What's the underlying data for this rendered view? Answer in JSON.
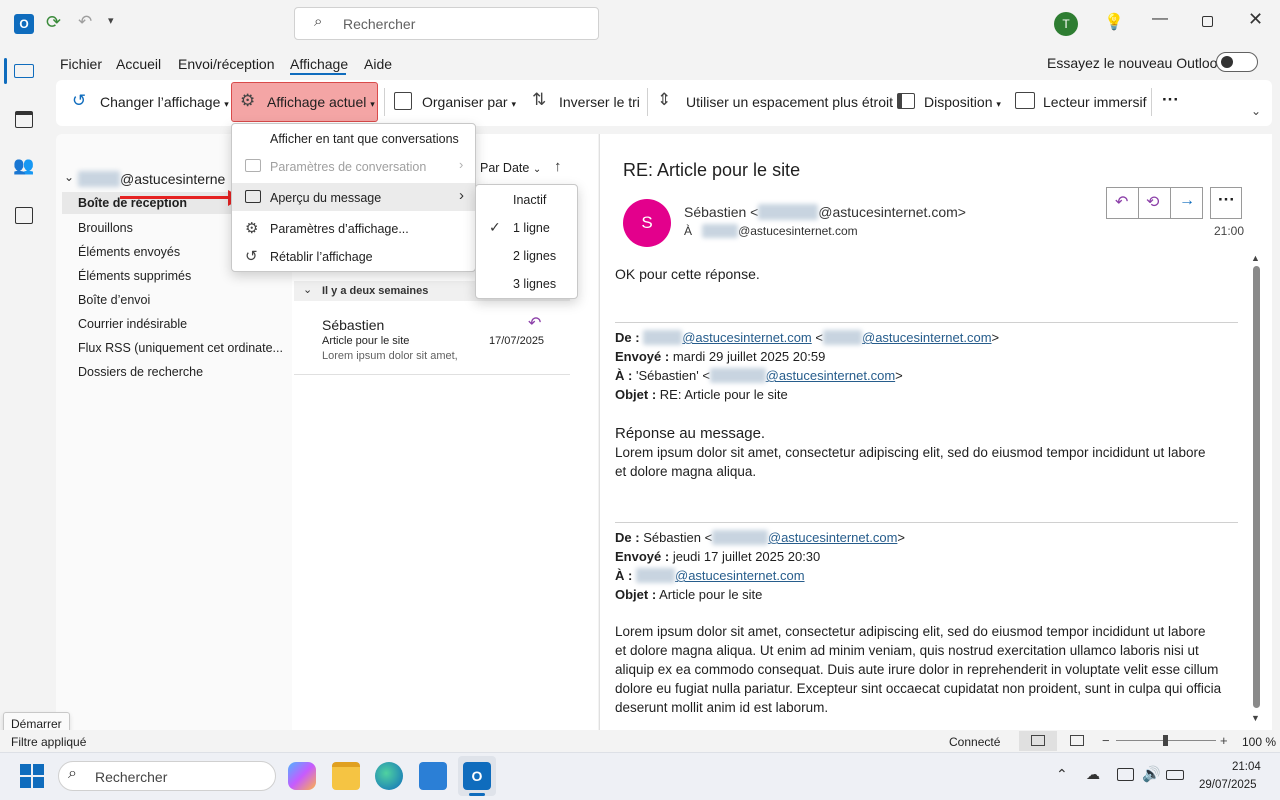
{
  "titlebar": {
    "search_placeholder": "Rechercher",
    "avatar_initial": "T"
  },
  "menubar": {
    "items": [
      "Fichier",
      "Accueil",
      "Envoi/réception",
      "Affichage",
      "Aide"
    ],
    "active": "Affichage",
    "try_new_label": "Essayez le nouveau Outlook"
  },
  "ribbon": {
    "change_view": "Changer l’affichage",
    "current_view": "Affichage actuel",
    "arrange_by": "Organiser par",
    "reverse_sort": "Inverser le tri",
    "compact_spacing": "Utiliser un espacement plus étroit",
    "layout": "Disposition",
    "immersive_reader": "Lecteur immersif",
    "more": "···"
  },
  "current_view_menu": {
    "items": [
      {
        "label": "Afficher en tant que conversations",
        "enabled": true
      },
      {
        "label": "Paramètres de conversation",
        "enabled": false,
        "submenu": true
      },
      {
        "label": "Aperçu du message",
        "enabled": true,
        "submenu": true,
        "highlighted": true
      },
      {
        "label": "Paramètres d’affichage...",
        "enabled": true
      },
      {
        "label": "Rétablir l’affichage",
        "enabled": true
      }
    ]
  },
  "preview_submenu": {
    "items": [
      "Inactif",
      "1 ligne",
      "2 lignes",
      "3 lignes"
    ],
    "checked": "1 ligne"
  },
  "folders": {
    "account": "@astucesinterne",
    "items": [
      "Boîte de réception",
      "Brouillons",
      "Éléments envoyés",
      "Éléments supprimés",
      "Boîte d’envoi",
      "Courrier indésirable",
      "Flux RSS (uniquement cet ordinate...",
      "Dossiers de recherche"
    ],
    "selected": "Boîte de réception"
  },
  "message_list": {
    "sort_label": "Par Date",
    "group_header": "Il y a deux semaines",
    "items": [
      {
        "sender": "Sébastien",
        "subject": "Article pour le site",
        "preview": "Lorem ipsum dolor sit amet,",
        "date": "17/07/2025"
      }
    ]
  },
  "reading_pane": {
    "subject": "RE: Article pour le site",
    "avatar_initial": "S",
    "from_name": "Sébastien <",
    "from_domain": "@astucesinternet.com>",
    "to_prefix": "À",
    "to_domain": "@astucesinternet.com",
    "time": "21:00",
    "body_intro": "OK pour cette réponse.",
    "quote1": {
      "from_label": "De :",
      "from_domain1": "@astucesinternet.com",
      "from_domain2": "@astucesinternet.com",
      "sent_label": "Envoyé :",
      "sent_value": "mardi 29 juillet 2025 20:59",
      "to_label": "À :",
      "to_value": "'Sébastien' <",
      "to_domain": "@astucesinternet.com",
      "subject_label": "Objet :",
      "subject_value": "RE: Article pour le site",
      "heading": "Réponse au message.",
      "body_line1": "Lorem ipsum dolor sit amet, consectetur adipiscing elit, sed do eiusmod tempor incididunt ut labore",
      "body_line2": "et dolore magna aliqua."
    },
    "quote2": {
      "from_label": "De :",
      "from_value": "Sébastien <",
      "from_domain": "@astucesinternet.com",
      "sent_label": "Envoyé :",
      "sent_value": "jeudi 17 juillet 2025 20:30",
      "to_label": "À :",
      "to_domain": "@astucesinternet.com",
      "subject_label": "Objet :",
      "subject_value": "Article pour le site",
      "body_lines": [
        "Lorem ipsum dolor sit amet, consectetur adipiscing elit, sed do eiusmod tempor incididunt ut labore",
        "et dolore magna aliqua. Ut enim ad minim veniam, quis nostrud exercitation ullamco laboris nisi ut",
        "aliquip ex ea commodo consequat. Duis aute irure dolor in reprehenderit in voluptate velit esse cillum",
        "dolore eu fugiat nulla pariatur. Excepteur sint occaecat cupidatat non proident, sunt in culpa qui officia",
        "deserunt mollit anim id est laborum."
      ]
    }
  },
  "statusbar": {
    "filter": "Filtre appliqué",
    "connection": "Connecté",
    "zoom": "100 %",
    "tooltip": "Démarrer"
  },
  "taskbar": {
    "search_placeholder": "Rechercher",
    "time": "21:04",
    "date": "29/07/2025"
  },
  "colors": {
    "accent": "#0f6cbd",
    "highlight_red": "#f4a5a5",
    "avatar_pink": "#e3008c",
    "avatar_green": "#2e7d32"
  }
}
